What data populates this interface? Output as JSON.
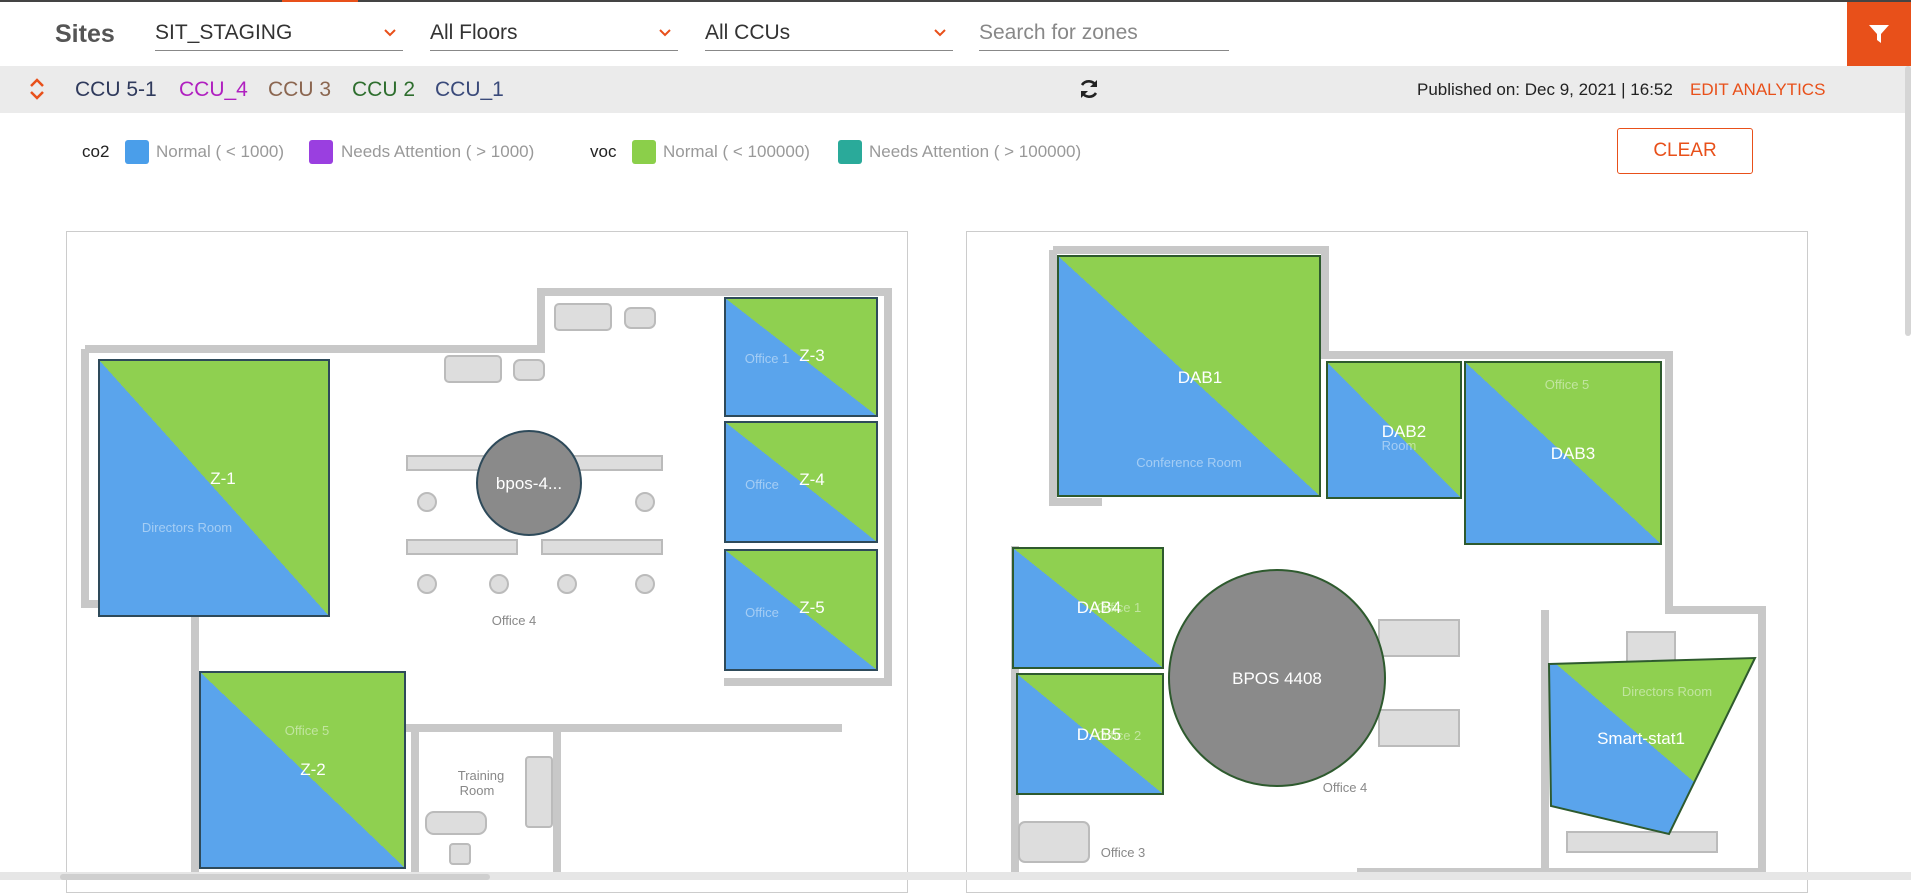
{
  "header": {
    "sites_label": "Sites",
    "site_select": "SIT_STAGING",
    "floors_select": "All Floors",
    "ccus_select": "All CCUs",
    "search_placeholder": "Search for zones",
    "filter_icon": "filter-icon"
  },
  "ccu_bar": {
    "ccus": [
      {
        "label": "CCU 5-1",
        "color": "#2f3a5c"
      },
      {
        "label": "CCU_4",
        "color": "#b020c0"
      },
      {
        "label": "CCU 3",
        "color": "#8b6650"
      },
      {
        "label": "CCU 2",
        "color": "#2e6e2e"
      },
      {
        "label": "CCU_1",
        "color": "#3a4a7a"
      }
    ],
    "published": "Published on: Dec 9, 2021 | 16:52",
    "edit_analytics": "EDIT ANALYTICS"
  },
  "legend": {
    "co2_label": "co2",
    "co2_normal": "Normal ( < 1000)",
    "co2_attention": "Needs Attention ( > 1000)",
    "voc_label": "voc",
    "voc_normal": "Normal ( < 100000)",
    "voc_attention": "Needs Attention ( > 100000)",
    "clear": "CLEAR",
    "colors": {
      "co2_normal": "#4a9eea",
      "co2_attention": "#9a3fe0",
      "voc_normal": "#8bcf4a",
      "voc_attention": "#2aaa9a"
    }
  },
  "floor_left": {
    "zones": {
      "z1": "Z-1",
      "z2": "Z-2",
      "z3": "Z-3",
      "z4": "Z-4",
      "z5": "Z-5",
      "bpos": "bpos-4..."
    },
    "rooms": {
      "directors": "Directors Room",
      "office5": "Office 5",
      "office4": "Office 4",
      "training1": "Training",
      "training2": "Room",
      "office1": "Office 1",
      "office_a": "Office",
      "office_b": "Office"
    }
  },
  "floor_right": {
    "zones": {
      "dab1": "DAB1",
      "dab2": "DAB2",
      "dab3": "DAB3",
      "dab4": "DAB4",
      "dab5": "DAB5",
      "bpos": "BPOS 4408",
      "smart": "Smart-stat1"
    },
    "rooms": {
      "conference": "Conference Room",
      "office5": "Office 5",
      "room": "Room",
      "office4": "Office 4",
      "office3": "Office 3",
      "directors": "Directors Room",
      "office2": "Office 2",
      "office1": "Office 1"
    }
  }
}
